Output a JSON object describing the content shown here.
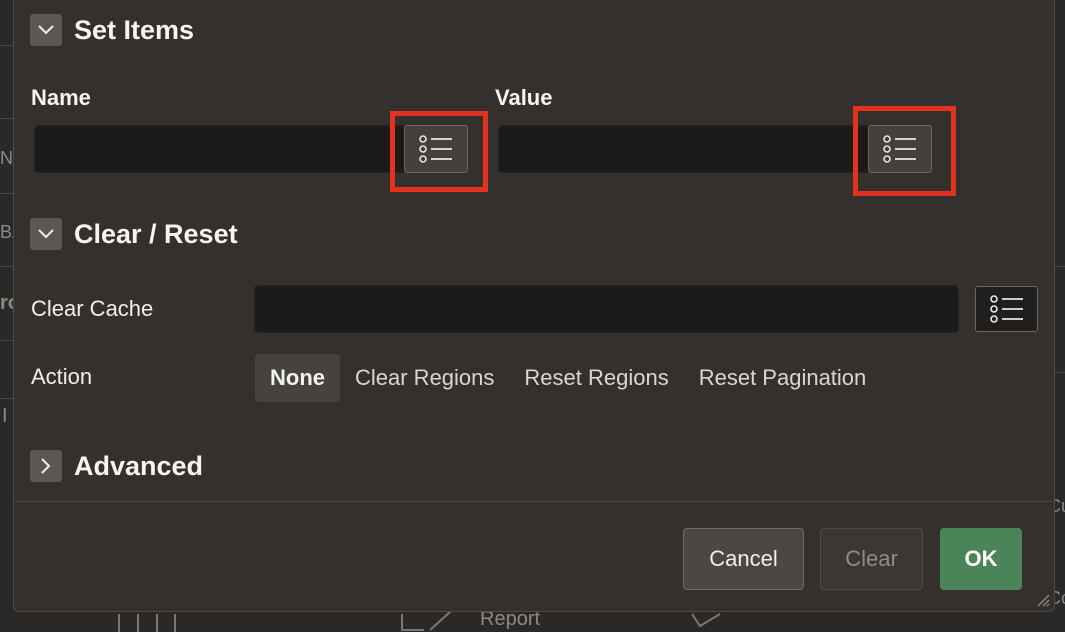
{
  "background": {
    "left_fragments": [
      "N",
      "BA",
      "ro",
      "I"
    ],
    "right_fragments": [
      "Cu",
      "Co"
    ],
    "bottom_text": "Report"
  },
  "dialog": {
    "sections": {
      "set_items": {
        "title": "Set Items",
        "name_label": "Name",
        "name_value": "",
        "value_label": "Value",
        "value_value": ""
      },
      "clear_reset": {
        "title": "Clear / Reset",
        "clear_cache_label": "Clear Cache",
        "clear_cache_value": "",
        "action_label": "Action",
        "action_options": [
          "None",
          "Clear Regions",
          "Reset Regions",
          "Reset Pagination"
        ],
        "action_selected": "None"
      },
      "advanced": {
        "title": "Advanced"
      }
    },
    "buttons": {
      "cancel": "Cancel",
      "clear": "Clear",
      "ok": "OK"
    }
  },
  "colors": {
    "dialog_bg": "#33302e",
    "input_bg": "#1c1b1a",
    "highlight": "#e5321f",
    "ok_button": "#4b8458"
  }
}
